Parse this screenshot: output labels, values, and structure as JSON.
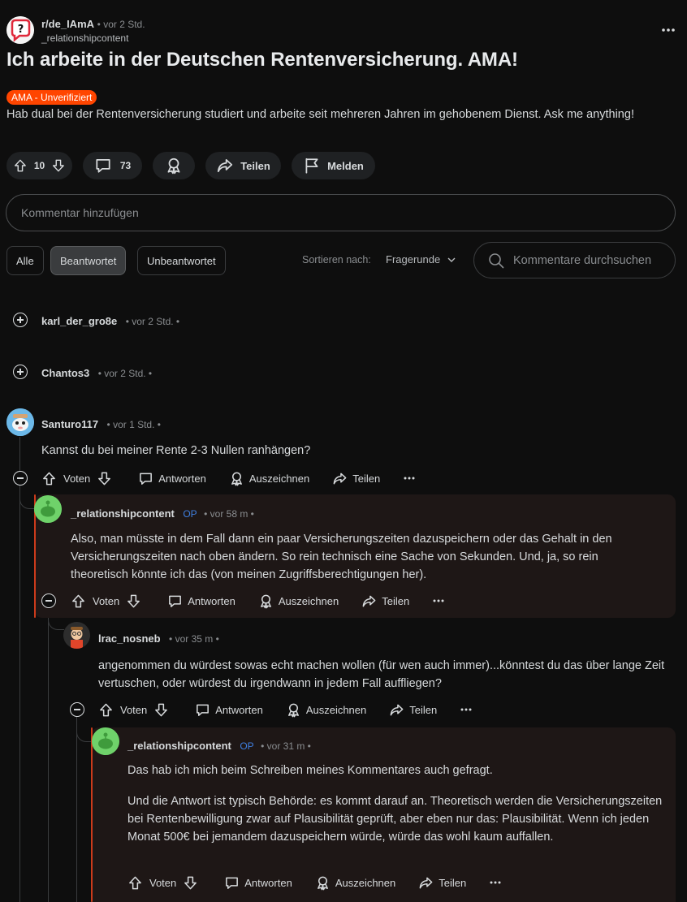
{
  "post": {
    "subreddit": "r/de_IAmA",
    "time": "• vor 2 Std.",
    "author": "_relationshipcontent",
    "title": "Ich arbeite in der Deutschen Rentenversicherung. AMA!",
    "flair": "AMA - Unverifiziert",
    "body": "Hab dual bei der Rentenversicherung studiert und arbeite seit mehreren Jahren im gehobenem Dienst. Ask me anything!",
    "votes": "10",
    "comments": "73",
    "share_label": "Teilen",
    "report_label": "Melden",
    "flair_color": "#ff4500"
  },
  "comment_box": {
    "placeholder": "Kommentar hinzufügen"
  },
  "filters": {
    "all": "Alle",
    "answered": "Beantwortet",
    "unanswered": "Unbeantwortet",
    "sort_label": "Sortieren nach:",
    "sort_value": "Fragerunde",
    "search_placeholder": "Kommentare durchsuchen"
  },
  "actions": {
    "vote": "Voten",
    "reply": "Antworten",
    "award": "Auszeichnen",
    "share": "Teilen"
  },
  "comments": [
    {
      "user": "karl_der_gro8e",
      "time": "• vor 2 Std. •"
    },
    {
      "user": "Chantos3",
      "time": "• vor 2 Std. •"
    },
    {
      "user": "Santuro117",
      "time": "• vor 1 Std. •",
      "text": "Kannst du bei meiner Rente 2-3 Nullen ranhängen?"
    },
    {
      "user": "_relationshipcontent",
      "op": "OP",
      "time": "• vor 58 m •",
      "text": "Also, man müsste in dem Fall dann ein paar Versicherungszeiten dazuspeichern oder das Gehalt in den Versicherungszeiten nach oben ändern. So rein technisch eine Sache von Sekunden. Und, ja, so rein theoretisch könnte ich das (von meinen Zugriffsberechtigungen her)."
    },
    {
      "user": "lrac_nosneb",
      "time": "• vor 35 m •",
      "text": "angenommen du würdest sowas echt machen wollen (für wen auch immer)...könntest du das über lange Zeit vertuschen, oder würdest du irgendwann in jedem Fall auffliegen?"
    },
    {
      "user": "_relationshipcontent",
      "op": "OP",
      "time": "• vor 31 m •",
      "text1": "Das hab ich mich beim Schreiben meines Kommentares auch gefragt.",
      "text2": "Und die Antwort ist typisch Behörde: es kommt darauf an. Theoretisch werden die Versicherungszeiten bei Rentenbewilligung zwar auf Plausibilität geprüft, aber eben nur das: Plausibilität. Wenn ich jeden Monat 500€ bei jemandem dazuspeichern würde, würde das wohl kaum auffallen."
    }
  ]
}
